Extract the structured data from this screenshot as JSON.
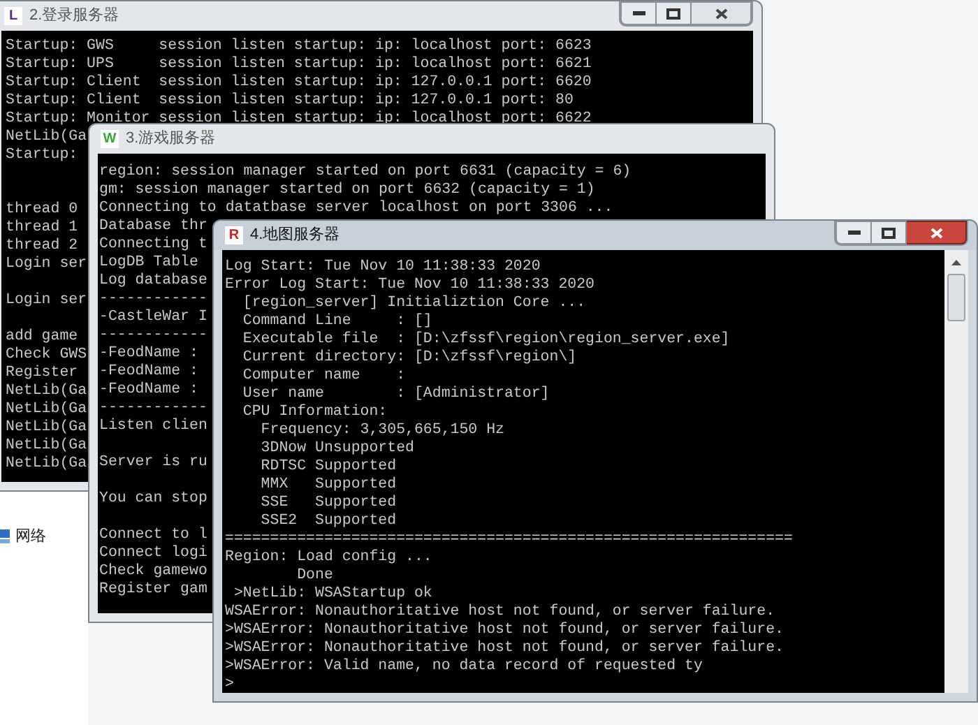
{
  "windows": [
    {
      "title": "2.登录服务器",
      "icon_letter": "L",
      "color": "#5a2d8c",
      "active": false,
      "has_buttons": true,
      "scrollbar": false,
      "lines": [
        {
          "kind": "text",
          "text": "Startup: GWS     session listen startup: ip: localhost port: 6623"
        },
        {
          "kind": "text",
          "text": "Startup: UPS     session listen startup: ip: localhost port: 6621"
        },
        {
          "kind": "text",
          "text": "Startup: Client  session listen startup: ip: 127.0.0.1 port: 6620"
        },
        {
          "kind": "text",
          "text": "Startup: Client  session listen startup: ip: 127.0.0.1 port: 80"
        },
        {
          "kind": "text",
          "text": "Startup: Monitor session listen startup: ip: localhost port: 6622"
        },
        {
          "kind": "text",
          "text": "NetLib(Ga"
        },
        {
          "kind": "text",
          "text": "Startup:"
        },
        {
          "kind": "blank"
        },
        {
          "kind": "blank"
        },
        {
          "kind": "text",
          "text": "thread 0"
        },
        {
          "kind": "text",
          "text": "thread 1"
        },
        {
          "kind": "text",
          "text": "thread 2"
        },
        {
          "kind": "text",
          "text": "Login ser"
        },
        {
          "kind": "blank"
        },
        {
          "kind": "text",
          "text": "Login ser"
        },
        {
          "kind": "blank"
        },
        {
          "kind": "text",
          "text": "add game"
        },
        {
          "kind": "text",
          "text": "Check GWS"
        },
        {
          "kind": "text",
          "text": "Register"
        },
        {
          "kind": "text",
          "text": "NetLib(Ga"
        },
        {
          "kind": "text",
          "text": "NetLib(Ga"
        },
        {
          "kind": "text",
          "text": "NetLib(Ga"
        },
        {
          "kind": "text",
          "text": "NetLib(Ga"
        },
        {
          "kind": "text",
          "text": "NetLib(Ga"
        }
      ]
    },
    {
      "title": "3.游戏服务器",
      "icon_letter": "W",
      "color": "#3aa63a",
      "active": false,
      "has_buttons": false,
      "scrollbar": false,
      "lines": [
        {
          "kind": "text",
          "text": "region: session manager started on port 6631 (capacity = 6)"
        },
        {
          "kind": "text",
          "text": "gm: session manager started on port 6632 (capacity = 1)"
        },
        {
          "kind": "text",
          "text": "Connecting to datatbase server localhost on port 3306 ..."
        },
        {
          "kind": "text",
          "text": "Database thr"
        },
        {
          "kind": "text",
          "text": "Connecting t"
        },
        {
          "kind": "text",
          "text": "LogDB Table"
        },
        {
          "kind": "text",
          "text": "Log database"
        },
        {
          "kind": "text",
          "text": "------------"
        },
        {
          "kind": "text",
          "text": "-CastleWar I"
        },
        {
          "kind": "text",
          "text": "------------"
        },
        {
          "kind": "text",
          "text": "-FeodName :"
        },
        {
          "kind": "text",
          "text": "-FeodName :"
        },
        {
          "kind": "text",
          "text": "-FeodName :"
        },
        {
          "kind": "text",
          "text": "------------"
        },
        {
          "kind": "text",
          "text": "Listen clien"
        },
        {
          "kind": "blank"
        },
        {
          "kind": "text",
          "text": "Server is ru"
        },
        {
          "kind": "blank"
        },
        {
          "kind": "text",
          "text": "You can stop"
        },
        {
          "kind": "blank"
        },
        {
          "kind": "text",
          "text": "Connect to l"
        },
        {
          "kind": "text",
          "text": "Connect logi"
        },
        {
          "kind": "text",
          "text": "Check gamewo"
        },
        {
          "kind": "text",
          "text": "Register gam"
        }
      ]
    },
    {
      "title": "4.地图服务器",
      "icon_letter": "R",
      "color": "#d42020",
      "active": true,
      "has_buttons": true,
      "scrollbar": true,
      "lines": [
        {
          "kind": "text",
          "text": "Log Start: Tue Nov 10 11:38:33 2020"
        },
        {
          "kind": "text",
          "text": "Error Log Start: Tue Nov 10 11:38:33 2020"
        },
        {
          "kind": "text",
          "text": "  [region_server] Initializtion Core ..."
        },
        {
          "kind": "text",
          "text": "  Command Line     : []"
        },
        {
          "kind": "text",
          "text": "  Executable file  : [D:\\zfssf\\region\\region_server.exe]"
        },
        {
          "kind": "text",
          "text": "  Current directory: [D:\\zfssf\\region\\]"
        },
        {
          "kind": "text",
          "text": "  Computer name    :"
        },
        {
          "kind": "text",
          "text": "  User name        : [Administrator]"
        },
        {
          "kind": "text",
          "text": "  CPU Information:"
        },
        {
          "kind": "text",
          "text": "    Frequency: 3,305,665,150 Hz"
        },
        {
          "kind": "text",
          "text": "    3DNow Unsupported"
        },
        {
          "kind": "text",
          "text": "    RDTSC Supported"
        },
        {
          "kind": "text",
          "text": "    MMX   Supported"
        },
        {
          "kind": "text",
          "text": "    SSE   Supported"
        },
        {
          "kind": "text",
          "text": "    SSE2  Supported"
        },
        {
          "kind": "text",
          "text": "==============================================================="
        },
        {
          "kind": "text",
          "text": "Region: Load config ..."
        },
        {
          "kind": "text",
          "text": "        Done"
        },
        {
          "kind": "text",
          "text": " >NetLib: WSAStartup ok"
        },
        {
          "kind": "text",
          "text": "WSAError: Nonauthoritative host not found, or server failure."
        },
        {
          "kind": "text",
          "text": ">WSAError: Nonauthoritative host not found, or server failure."
        },
        {
          "kind": "text",
          "text": ">WSAError: Nonauthoritative host not found, or server failure."
        },
        {
          "kind": "text",
          "text": ">WSAError: Valid name, no data record of requested ty"
        },
        {
          "kind": "text",
          "text": ">"
        }
      ]
    }
  ],
  "desktop_items": [
    {
      "label": "网络"
    }
  ]
}
